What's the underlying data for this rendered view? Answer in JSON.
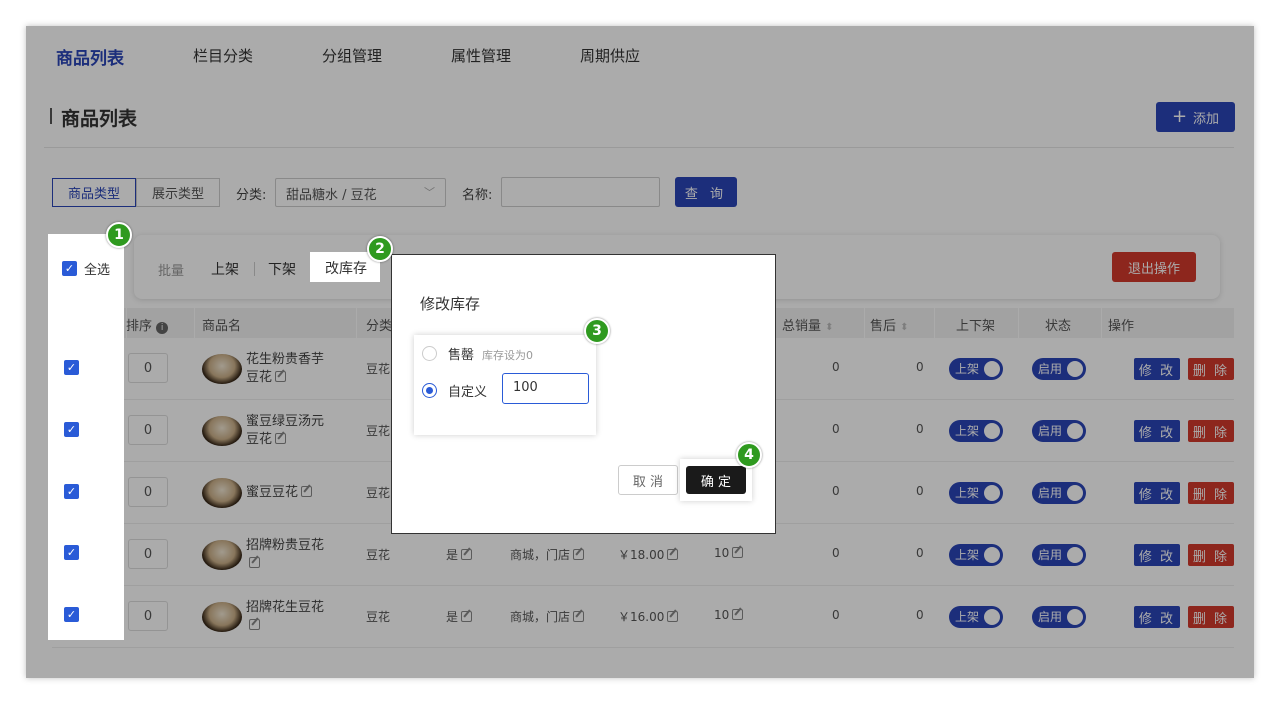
{
  "nav": {
    "items": [
      "商品列表",
      "栏目分类",
      "分组管理",
      "属性管理",
      "周期供应"
    ]
  },
  "page": {
    "title": "商品列表",
    "add_label": "添加"
  },
  "filter": {
    "seg_product": "商品类型",
    "seg_display": "展示类型",
    "category_label": "分类:",
    "category_value": "甜品糖水 / 豆花",
    "name_label": "名称:",
    "name_value": "",
    "query_label": "查 询"
  },
  "batch": {
    "select_all": "全选",
    "batch": "批量",
    "on_shelf": "上架",
    "off_shelf": "下架",
    "edit_stock": "改库存",
    "exit": "退出操作"
  },
  "columns": [
    "排序",
    "商品名",
    "分类",
    "总销量",
    "售后",
    "上下架",
    "状态",
    "操作"
  ],
  "rows": [
    {
      "sort": "0",
      "name": "花生粉贵香芋豆花",
      "category": "豆花",
      "yes": "",
      "channel": "",
      "price": "",
      "stock": "",
      "sales": "0",
      "after": "0",
      "shelf": "上架",
      "status": "启用",
      "mod": "修 改",
      "del": "删 除"
    },
    {
      "sort": "0",
      "name": "蜜豆绿豆汤元豆花",
      "category": "豆花",
      "yes": "",
      "channel": "",
      "price": "",
      "stock": "",
      "sales": "0",
      "after": "0",
      "shelf": "上架",
      "status": "启用",
      "mod": "修 改",
      "del": "删 除"
    },
    {
      "sort": "0",
      "name": "蜜豆豆花",
      "category": "豆花",
      "yes": "",
      "channel": "",
      "price": "",
      "stock": "",
      "sales": "0",
      "after": "0",
      "shelf": "上架",
      "status": "启用",
      "mod": "修 改",
      "del": "删 除"
    },
    {
      "sort": "0",
      "name": "招牌粉贵豆花",
      "category": "豆花",
      "yes": "是",
      "channel": "商城，门店",
      "price": "￥18.00",
      "stock": "10",
      "sales": "0",
      "after": "0",
      "shelf": "上架",
      "status": "启用",
      "mod": "修 改",
      "del": "删 除"
    },
    {
      "sort": "0",
      "name": "招牌花生豆花",
      "category": "豆花",
      "yes": "是",
      "channel": "商城，门店",
      "price": "￥16.00",
      "stock": "10",
      "sales": "0",
      "after": "0",
      "shelf": "上架",
      "status": "启用",
      "mod": "修 改",
      "del": "删 除"
    }
  ],
  "modal": {
    "title": "修改库存",
    "opt_soldout": "售罄",
    "opt_soldout_hint": "库存设为0",
    "opt_custom": "自定义",
    "custom_value": "100",
    "cancel": "取 消",
    "confirm": "确 定"
  },
  "steps": [
    "1",
    "2",
    "3",
    "4"
  ],
  "colors": {
    "primary": "#2a45b8",
    "danger": "#d33a2c",
    "step": "#2f9a1f"
  }
}
